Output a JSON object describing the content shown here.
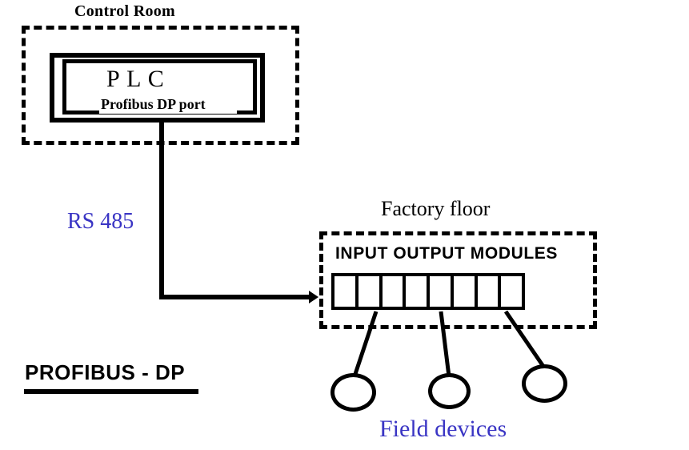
{
  "diagram": {
    "title": "PROFIBUS - DP",
    "accent_color": "#3A35C4",
    "line_color": "#000000",
    "background_color": "#FFFFFF"
  },
  "control_room": {
    "label": "Control Room",
    "plc": {
      "title": "P  L  C",
      "port_label": "Profibus DP port"
    }
  },
  "network": {
    "bus_label": "RS 485"
  },
  "factory_floor": {
    "label": "Factory floor",
    "io_modules": {
      "title": "INPUT OUTPUT MODULES",
      "slots": [
        "1",
        "2",
        "3",
        "4",
        "5",
        "6",
        "7",
        "8"
      ]
    },
    "field_devices": {
      "label": "Field devices",
      "devices": [
        "device-1",
        "device-2",
        "device-3"
      ]
    }
  }
}
